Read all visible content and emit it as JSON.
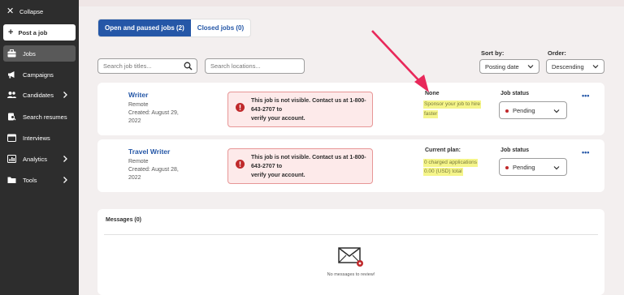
{
  "sidebar": {
    "collapse_label": "Collapse",
    "post_job_label": "Post a job",
    "items": [
      {
        "label": "Jobs",
        "icon": "briefcase-icon"
      },
      {
        "label": "Campaigns",
        "icon": "megaphone-icon"
      },
      {
        "label": "Candidates",
        "icon": "people-icon"
      },
      {
        "label": "Search resumes",
        "icon": "search-icon"
      },
      {
        "label": "Interviews",
        "icon": "calendar-icon"
      },
      {
        "label": "Analytics",
        "icon": "chart-icon"
      },
      {
        "label": "Tools",
        "icon": "folder-icon"
      }
    ]
  },
  "tabs": {
    "open_label": "Open and paused jobs (2)",
    "closed_label": "Closed jobs (0)"
  },
  "filters": {
    "search_jobs_placeholder": "Search job titles...",
    "search_locations_placeholder": "Search locations...",
    "sort_by_label": "Sort by:",
    "sort_by_value": "Posting date",
    "order_label": "Order:",
    "order_value": "Descending"
  },
  "jobs": [
    {
      "title": "Writer",
      "location": "Remote",
      "created": "Created: August 29,",
      "created_year": "2022",
      "alert_line1": "This job is not visible. Contact us at 1-800-643-2707 to",
      "alert_line2": "verify your account.",
      "plan_label": "None",
      "plan_line1": "Sponsor your job to hire",
      "plan_line2": "faster",
      "status_label": "Job status",
      "status_value": "Pending"
    },
    {
      "title": "Travel Writer",
      "location": "Remote",
      "created": "Created: August 28,",
      "created_year": "2022",
      "alert_line1": "This job is not visible. Contact us at 1-800-643-2707 to",
      "alert_line2": "verify your account.",
      "plan_label": "Current plan:",
      "plan_line1": "0 charged applications",
      "plan_line2": "0.00 (USD) total",
      "status_label": "Job status",
      "status_value": "Pending"
    }
  ],
  "messages": {
    "title": "Messages (0)",
    "empty_text": "No messages to review!"
  },
  "colors": {
    "sidebar_bg": "#2d2d2d",
    "accent_blue": "#2557a7",
    "alert_bg": "#fdeaea",
    "alert_border": "#e79696",
    "error_red": "#c0292b",
    "annotation_arrow": "#e8285a",
    "highlight": "#f5f58a"
  }
}
